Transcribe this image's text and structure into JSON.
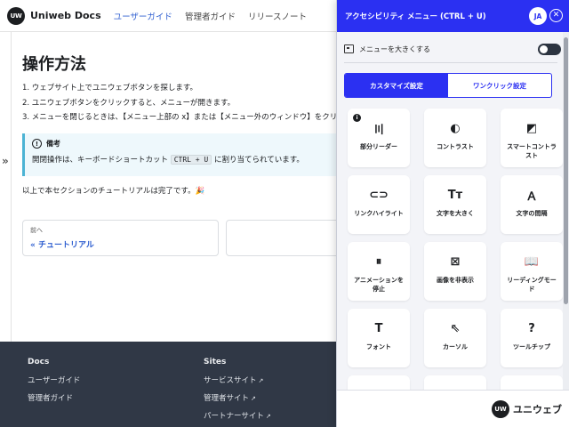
{
  "site": {
    "logo_mark": "UW",
    "logo_text": "Uniweb Docs",
    "nav": [
      "ユーザーガイド",
      "管理者ガイド",
      "リリースノート"
    ],
    "expand_glyph": "»"
  },
  "content": {
    "title": "操作方法",
    "steps": [
      "1. ウェブサイト上でユニウェブボタンを探します。",
      "2. ユニウェブボタンをクリックすると、メニューが開きます。",
      "3. メニューを閉じるときは、【メニュー上部の x】または【メニュー外のウィンドウ】をクリ"
    ],
    "note": {
      "icon": "!",
      "title": "備考",
      "text_before": "開閉操作は、キーボードショートカット ",
      "kbd": "CTRL + U",
      "text_after": " に割り当てられています。"
    },
    "done_text": "以上で本セクションのチュートリアルは完了です。🎉",
    "pager": {
      "prev_sub": "前へ",
      "prev_label": "« チュートリアル"
    }
  },
  "footer": {
    "docs": {
      "heading": "Docs",
      "links": [
        "ユーザーガイド",
        "管理者ガイド"
      ]
    },
    "sites": {
      "heading": "Sites",
      "links": [
        "サービスサイト",
        "管理者サイト",
        "パートナーサイト"
      ]
    }
  },
  "panel": {
    "title": "アクセシビリティ メニュー (CTRL + U)",
    "avatar": "JA",
    "close": "✕",
    "enlarge_label": "メニューを大きくする",
    "enlarge_on": false,
    "tabs": [
      "カスタマイズ設定",
      "ワンクリック設定"
    ],
    "cards": [
      {
        "label": "部分リーダー",
        "icon": "audio-wave-icon",
        "glyph": "〣",
        "info": "i"
      },
      {
        "label": "コントラスト",
        "icon": "contrast-icon",
        "glyph": "◐"
      },
      {
        "label": "スマートコントラスト",
        "icon": "smart-contrast-icon",
        "glyph": "◩"
      },
      {
        "label": "リンクハイライト",
        "icon": "link-icon",
        "glyph": "⊂⊃"
      },
      {
        "label": "文字を大きく",
        "icon": "text-size-icon",
        "glyph": "Tт"
      },
      {
        "label": "文字の間隔",
        "icon": "text-spacing-icon",
        "glyph": "Ａ"
      },
      {
        "label": "アニメーションを停止",
        "icon": "pause-icon",
        "glyph": "⏸"
      },
      {
        "label": "画像を非表示",
        "icon": "hide-image-icon",
        "glyph": "⊠"
      },
      {
        "label": "リーディングモード",
        "icon": "book-icon",
        "glyph": "📖"
      },
      {
        "label": "フォント",
        "icon": "font-icon",
        "glyph": "T"
      },
      {
        "label": "カーソル",
        "icon": "cursor-icon",
        "glyph": "⇖"
      },
      {
        "label": "ツールチップ",
        "icon": "tooltip-icon",
        "glyph": "?"
      },
      {
        "label": "",
        "icon": "partial-card-icon",
        "glyph": ""
      },
      {
        "label": "",
        "icon": "partial-card-icon",
        "glyph": ""
      },
      {
        "label": "",
        "icon": "partial-card-icon",
        "glyph": ""
      }
    ],
    "brand_mark": "UW",
    "brand_text": "ユニウェブ"
  },
  "colors": {
    "accent": "#2b30f2",
    "link": "#2f5fd0",
    "footer_bg": "#303846",
    "note_border": "#4cb3d4"
  }
}
